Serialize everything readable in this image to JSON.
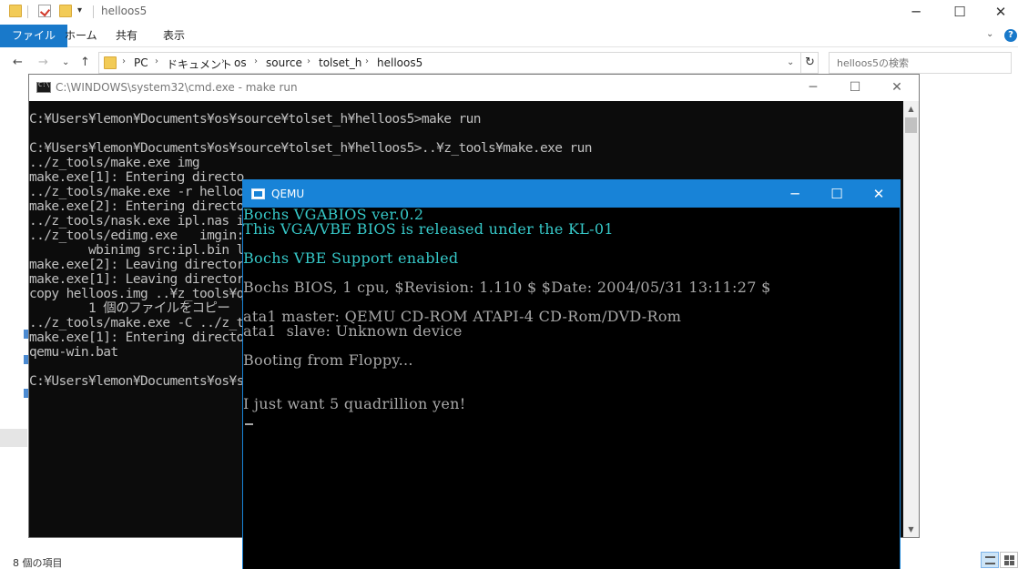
{
  "explorer": {
    "title": "helloos5",
    "quick_access": {
      "dropdown_glyph": "▾"
    },
    "controls": {
      "minimize": "─",
      "maximize": "☐",
      "close": "✕"
    },
    "ribbon": {
      "tabs": [
        {
          "label": "ファイル",
          "active": true
        },
        {
          "label": "ホーム",
          "active": false
        },
        {
          "label": "共有",
          "active": false
        },
        {
          "label": "表示",
          "active": false
        }
      ],
      "expand_glyph": "⌄",
      "help_glyph": "?"
    },
    "nav": {
      "back": "←",
      "forward": "→",
      "recent": "⌄",
      "up": "↑"
    },
    "address": {
      "breadcrumbs": [
        "PC",
        "ドキュメント",
        "os",
        "source",
        "tolset_h",
        "helloos5"
      ],
      "separator": "›",
      "dropdown_glyph": "⌄",
      "refresh_glyph": "↻"
    },
    "search": {
      "placeholder": "helloos5の検索"
    },
    "status": {
      "item_count": "8 個の項目"
    },
    "accent_color": "#1979ca"
  },
  "cmd": {
    "title": "C:\\WINDOWS\\system32\\cmd.exe - make  run",
    "controls": {
      "minimize": "─",
      "maximize": "☐",
      "close": "✕"
    },
    "scroll": {
      "up": "▲",
      "down": "▼"
    },
    "lines": [
      "C:¥Users¥lemon¥Documents¥os¥source¥tolset_h¥helloos5>make run",
      "",
      "C:¥Users¥lemon¥Documents¥os¥source¥tolset_h¥helloos5>..¥z_tools¥make.exe run",
      "../z_tools/make.exe img",
      "make.exe[1]: Entering directo",
      "../z_tools/make.exe -r helloos",
      "make.exe[2]: Entering directo",
      "../z_tools/nask.exe ipl.nas ip",
      "../z_tools/edimg.exe   imgin:",
      "        wbinimg src:ipl.bin le",
      "make.exe[2]: Leaving director",
      "make.exe[1]: Leaving director",
      "copy helloos.img ..¥z_tools¥qe",
      "        1 個のファイルをコピー",
      "../z_tools/make.exe -C ../z_to",
      "make.exe[1]: Entering directo",
      "qemu-win.bat",
      "",
      "C:¥Users¥lemon¥Documents¥os¥so"
    ],
    "text_color": "#c0c0c0"
  },
  "qemu": {
    "title": "QEMU",
    "controls": {
      "minimize": "─",
      "maximize": "☐",
      "close": "✕"
    },
    "lines": [
      {
        "text": "Bochs VGABIOS ver.0.2",
        "color": "cyan"
      },
      {
        "text": "This VGA/VBE BIOS is released under the KL-01",
        "color": "cyan"
      },
      {
        "text": "Bochs VBE Support enabled",
        "color": "cyan"
      },
      {
        "text": "Bochs BIOS, 1 cpu, $Revision: 1.110 $ $Date: 2004/05/31 13:11:27 $",
        "color": "gray"
      },
      {
        "text": "ata1 master: QEMU CD-ROM ATAPI-4 CD-Rom/DVD-Rom",
        "color": "gray"
      },
      {
        "text": "ata1  slave: Unknown device",
        "color": "gray"
      },
      {
        "text": "Booting from Floppy...",
        "color": "gray"
      },
      {
        "text": "I just want 5 quadrillion yen!",
        "color": "gray"
      }
    ],
    "title_color": "#1883d7",
    "cyan_color": "#36c8c8",
    "gray_color": "#a8a8a8"
  }
}
